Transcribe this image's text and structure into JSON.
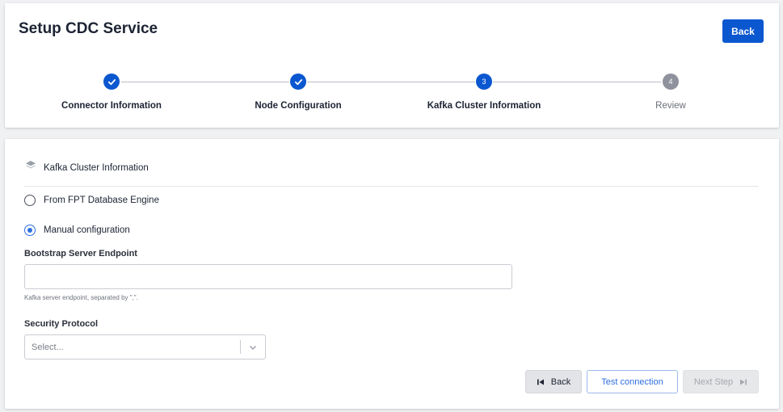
{
  "header": {
    "title": "Setup CDC Service",
    "back_label": "Back"
  },
  "stepper": {
    "steps": [
      {
        "number": "1",
        "label": "Connector Information",
        "state": "done"
      },
      {
        "number": "2",
        "label": "Node Configuration",
        "state": "done"
      },
      {
        "number": "3",
        "label": "Kafka Cluster Information",
        "state": "current"
      },
      {
        "number": "4",
        "label": "Review",
        "state": "pending"
      }
    ]
  },
  "form": {
    "section_title": "Kafka Cluster Information",
    "section_icon": "layers-icon",
    "source_options": [
      {
        "label": "From FPT Database Engine",
        "checked": false
      },
      {
        "label": "Manual configuration",
        "checked": true
      }
    ],
    "bootstrap": {
      "label": "Bootstrap Server Endpoint",
      "value": "",
      "hint": "Kafka server endpoint, separated by \",\"."
    },
    "security_protocol": {
      "label": "Security Protocol",
      "placeholder": "Select..."
    },
    "actions": {
      "back_label": "Back",
      "test_label": "Test connection",
      "next_label": "Next Step"
    }
  },
  "colors": {
    "primary": "#0b57d0",
    "pending_step": "#8f929c",
    "radio_checked": "#2f6fdf"
  }
}
